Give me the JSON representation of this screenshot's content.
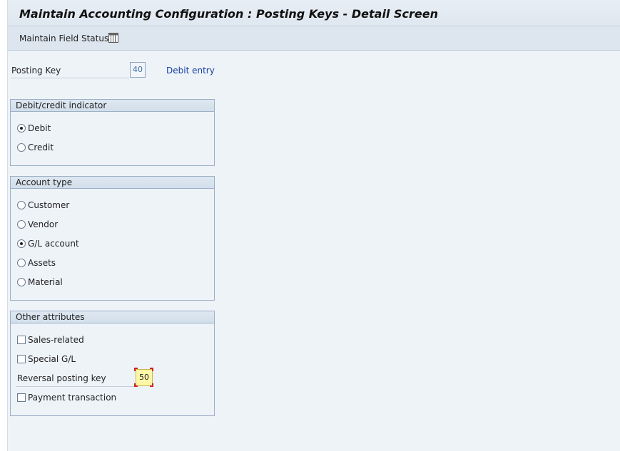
{
  "title": "Maintain Accounting Configuration : Posting Keys - Detail Screen",
  "toolbar": {
    "label": "Maintain Field Status",
    "icon": "table-grid-icon"
  },
  "posting_key": {
    "label": "Posting Key",
    "value": "40",
    "description": "Debit entry"
  },
  "debit_credit": {
    "heading": "Debit/credit indicator",
    "options": [
      {
        "label": "Debit",
        "selected": true
      },
      {
        "label": "Credit",
        "selected": false
      }
    ]
  },
  "account_type": {
    "heading": "Account type",
    "options": [
      {
        "label": "Customer",
        "selected": false
      },
      {
        "label": "Vendor",
        "selected": false
      },
      {
        "label": "G/L account",
        "selected": true
      },
      {
        "label": "Assets",
        "selected": false
      },
      {
        "label": "Material",
        "selected": false
      }
    ]
  },
  "other_attributes": {
    "heading": "Other attributes",
    "sales_related": {
      "label": "Sales-related",
      "checked": false
    },
    "special_gl": {
      "label": "Special G/L",
      "checked": false
    },
    "reversal_key": {
      "label": "Reversal posting key",
      "value": "50"
    },
    "payment_transaction": {
      "label": "Payment transaction",
      "checked": false
    }
  },
  "colors": {
    "accent_text": "#1a3fa0",
    "focus_field": "#fff7a8",
    "focus_corner": "#cc2222"
  }
}
